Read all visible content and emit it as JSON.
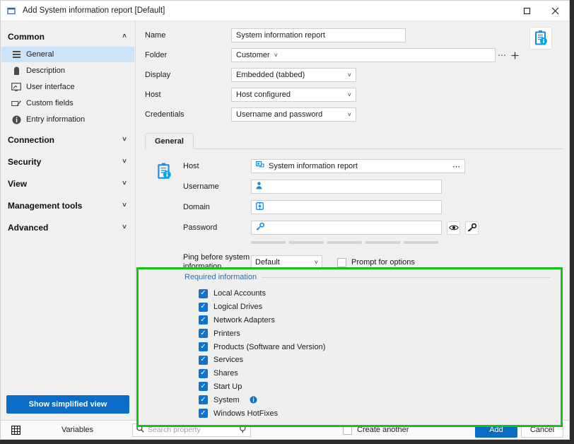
{
  "window": {
    "title": "Add System information report [Default]",
    "icon": "window-restore-icon",
    "maximize": "□",
    "close": "✕"
  },
  "sidebar": {
    "groups": [
      {
        "label": "Common",
        "expanded": true,
        "chevron": "˄",
        "items": [
          {
            "label": "General",
            "icon": "lines-icon",
            "selected": true
          },
          {
            "label": "Description",
            "icon": "tag-icon",
            "selected": false
          },
          {
            "label": "User interface",
            "icon": "monitor-icon",
            "selected": false
          },
          {
            "label": "Custom fields",
            "icon": "edit-field-icon",
            "selected": false
          },
          {
            "label": "Entry information",
            "icon": "info-icon",
            "selected": false
          }
        ]
      },
      {
        "label": "Connection",
        "expanded": false,
        "chevron": "˅",
        "items": []
      },
      {
        "label": "Security",
        "expanded": false,
        "chevron": "˅",
        "items": []
      },
      {
        "label": "View",
        "expanded": false,
        "chevron": "˅",
        "items": []
      },
      {
        "label": "Management tools",
        "expanded": false,
        "chevron": "˅",
        "items": []
      },
      {
        "label": "Advanced",
        "expanded": false,
        "chevron": "˅",
        "items": []
      }
    ],
    "simplified_button": "Show simplified view"
  },
  "form": {
    "name_label": "Name",
    "name_value": "System information report",
    "folder_label": "Folder",
    "folder_value": "Customer",
    "folder_caret": "˅",
    "folder_more": "⋯",
    "folder_add": "+",
    "display_label": "Display",
    "display_value": "Embedded (tabbed)",
    "host_label": "Host",
    "host_value": "Host configured",
    "credentials_label": "Credentials",
    "credentials_value": "Username and password",
    "caret": "˅"
  },
  "tabs": [
    {
      "label": "General",
      "active": true
    }
  ],
  "general": {
    "host_label": "Host",
    "host_value": "System information report",
    "host_more": "⋯",
    "username_label": "Username",
    "username_value": "",
    "domain_label": "Domain",
    "domain_value": "",
    "password_label": "Password",
    "password_value": "",
    "reveal_icon": "eye-icon",
    "generate_icon": "key-tool-icon",
    "strength_segments": 5,
    "ping_label": "Ping before system information",
    "ping_value": "Default",
    "ping_caret": "˅",
    "prompt_label": "Prompt for options",
    "prompt_checked": false
  },
  "required_information": {
    "legend": "Required information",
    "highlight_color": "#14c414",
    "items": [
      {
        "label": "Local Accounts",
        "checked": true,
        "info": false
      },
      {
        "label": "Logical Drives",
        "checked": true,
        "info": false
      },
      {
        "label": "Network Adapters",
        "checked": true,
        "info": false
      },
      {
        "label": "Printers",
        "checked": true,
        "info": false
      },
      {
        "label": "Products (Software and Version)",
        "checked": true,
        "info": false
      },
      {
        "label": "Services",
        "checked": true,
        "info": false
      },
      {
        "label": "Shares",
        "checked": true,
        "info": false
      },
      {
        "label": "Start Up",
        "checked": true,
        "info": false
      },
      {
        "label": "System",
        "checked": true,
        "info": true
      },
      {
        "label": "Windows HotFixes",
        "checked": true,
        "info": false
      }
    ],
    "check_glyph": "✓"
  },
  "statusbar": {
    "grid_icon": "grid-icon",
    "variables_label": "Variables",
    "search_placeholder": "Search property",
    "search_value": "",
    "create_another_label": "Create another",
    "create_another_checked": false,
    "add_label": "Add",
    "cancel_label": "Cancel"
  },
  "colors": {
    "accent": "#0a6cc6",
    "checkbox": "#1273cd",
    "selection": "#cbe4f7",
    "legend_text": "#2d6fa8"
  }
}
